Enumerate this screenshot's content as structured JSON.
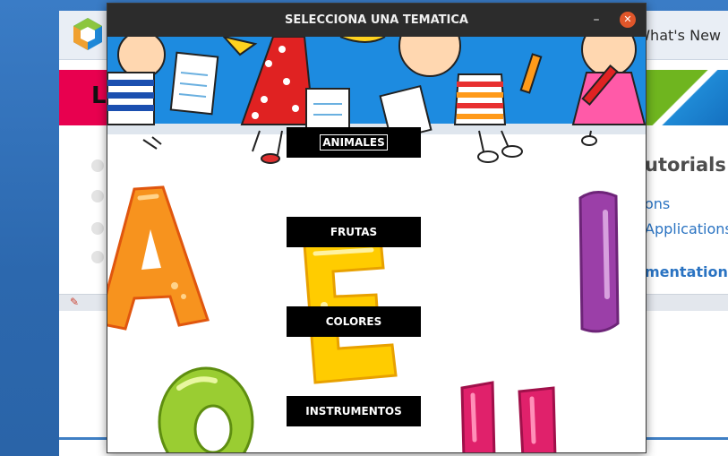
{
  "background_app": {
    "header_link": "What's New",
    "heading_fragment": "L",
    "tutorials_heading": "utorials",
    "links": [
      "ons",
      "Applications",
      "mentation"
    ]
  },
  "dialog": {
    "title": "SELECCIONA UNA TEMATICA",
    "minimize_symbol": "–",
    "close_symbol": "✕",
    "buttons": [
      {
        "label": "ANIMALES",
        "focused": true
      },
      {
        "label": "FRUTAS",
        "focused": false
      },
      {
        "label": "COLORES",
        "focused": false
      },
      {
        "label": "INSTRUMENTOS",
        "focused": false
      }
    ],
    "illustration": {
      "banner_colors": {
        "sky": "#1d8be0",
        "ground": "#dfe6ee"
      },
      "letters": [
        {
          "char": "A",
          "color": "#f7931e"
        },
        {
          "char": "E",
          "color": "#ffcc00"
        },
        {
          "char": "I",
          "color": "#9b3fa8"
        },
        {
          "char": "O",
          "color": "#9acd32"
        },
        {
          "char": "U",
          "color": "#e0216b"
        }
      ]
    }
  },
  "colors": {
    "titlebar": "#2c2c2c",
    "close_button": "#e0562a",
    "button_bg": "#000000",
    "desktop_blue": "#2f6fb8"
  }
}
